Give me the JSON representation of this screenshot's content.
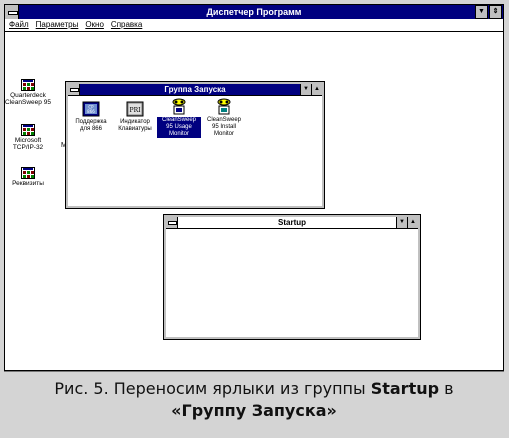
{
  "program_manager": {
    "title": "Диспетчер Программ",
    "menu": [
      "Файл",
      "Параметры",
      "Окно",
      "Справка"
    ],
    "title_buttons": [
      "▼",
      "⇕"
    ]
  },
  "desktop_icons": [
    {
      "label": "Quarterdeck CleanSweep 95"
    },
    {
      "label": "Microsoft TCP/IP-32"
    },
    {
      "label": "Реквизиты"
    }
  ],
  "desktop_fragment": "M",
  "group_window": {
    "title": "Группа Запуска",
    "buttons": [
      "▼",
      "▲"
    ],
    "items": [
      {
        "label": "Поддержка для 866",
        "icon": "cp-866-icon",
        "icon_text": "CP 866"
      },
      {
        "label": "Индикатор Клавиатуры",
        "icon": "keyboard-indicator-icon",
        "icon_text": "PRI"
      },
      {
        "label": "CleanSweep 95 Usage Monitor",
        "icon": "cleansweep-usage-icon",
        "selected": true
      },
      {
        "label": "CleanSweep 95 Install Monitor",
        "icon": "cleansweep-install-icon"
      }
    ]
  },
  "startup_window": {
    "title": "Startup",
    "buttons": [
      "▼",
      "▲"
    ]
  },
  "caption": {
    "part1": "Рис. 5. Переносим ярлыки из группы ",
    "bold1": "Startup",
    "part2": " в",
    "bold2": "«Группу Запуска»"
  },
  "colors": {
    "active_title": "#000080",
    "selection": "#000080",
    "frame_bg": "#d4d4d4"
  }
}
